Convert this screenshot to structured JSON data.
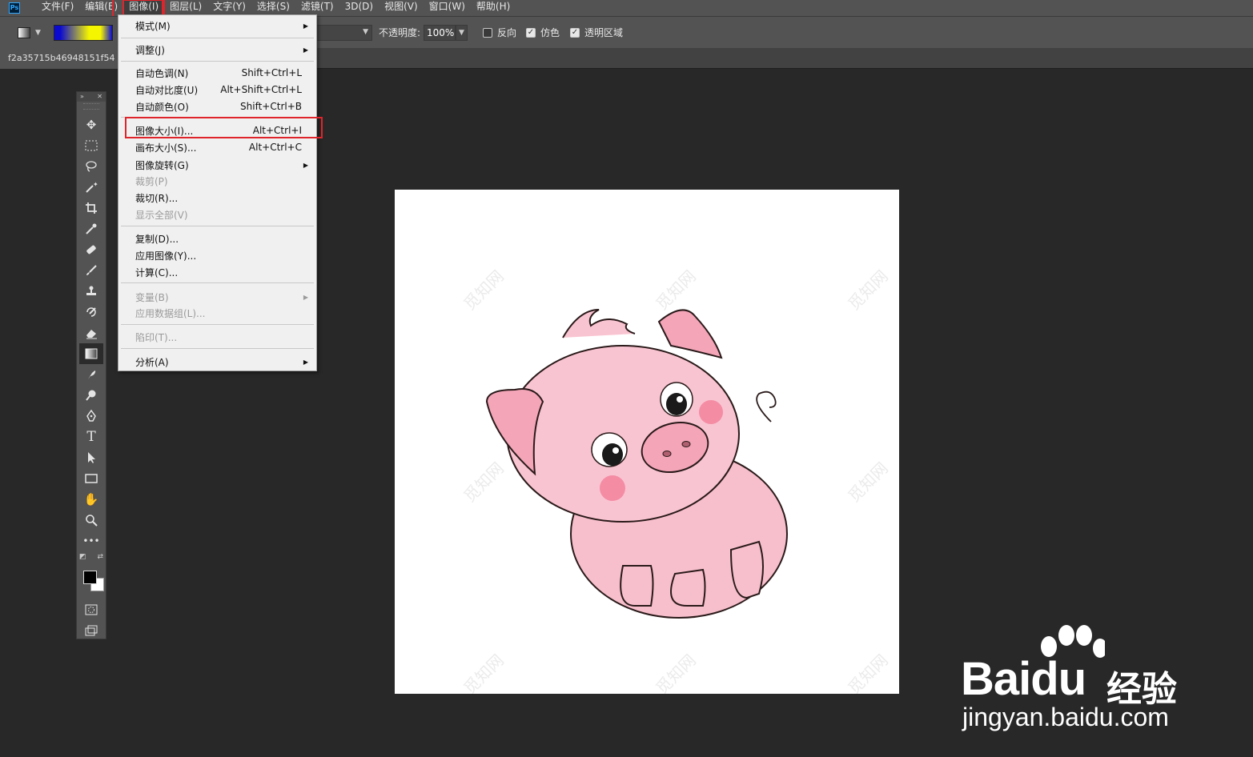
{
  "menubar": {
    "items": [
      "文件(F)",
      "编辑(E)",
      "图像(I)",
      "图层(L)",
      "文字(Y)",
      "选择(S)",
      "滤镜(T)",
      "3D(D)",
      "视图(V)",
      "窗口(W)",
      "帮助(H)"
    ],
    "active_index": 2
  },
  "options": {
    "opacity_label": "不透明度:",
    "opacity_value": "100%",
    "reverse_label": "反向",
    "dither_label": "仿色",
    "transparency_label": "透明区域",
    "reverse_checked": false,
    "dither_checked": true,
    "transparency_checked": true
  },
  "document": {
    "tab_title": "f2a35715b46948151f54"
  },
  "image_menu": {
    "mode": "模式(M)",
    "adjust": "调整(J)",
    "auto_tone": "自动色调(N)",
    "auto_tone_sc": "Shift+Ctrl+L",
    "auto_contrast": "自动对比度(U)",
    "auto_contrast_sc": "Alt+Shift+Ctrl+L",
    "auto_color": "自动颜色(O)",
    "auto_color_sc": "Shift+Ctrl+B",
    "image_size": "图像大小(I)...",
    "image_size_sc": "Alt+Ctrl+I",
    "canvas_size": "画布大小(S)...",
    "canvas_size_sc": "Alt+Ctrl+C",
    "image_rotation": "图像旋转(G)",
    "crop": "裁剪(P)",
    "trim": "裁切(R)...",
    "reveal_all": "显示全部(V)",
    "duplicate": "复制(D)...",
    "apply_image": "应用图像(Y)...",
    "calculations": "计算(C)...",
    "variables": "变量(B)",
    "apply_dataset": "应用数据组(L)...",
    "trap": "陷印(T)...",
    "analysis": "分析(A)"
  },
  "canvas": {
    "watermark": "觅知网"
  },
  "baidu": {
    "brand": "Bai",
    "du": "du",
    "jingyan": "经验",
    "url": "jingyan.baidu.com"
  },
  "icons": {
    "app": "ps-logo-icon",
    "tools": [
      "move-icon",
      "marquee-icon",
      "lasso-icon",
      "magic-wand-icon",
      "crop-icon",
      "eyedropper-icon",
      "healing-brush-icon",
      "brush-icon",
      "clone-stamp-icon",
      "history-brush-icon",
      "eraser-icon",
      "gradient-icon",
      "blur-icon",
      "dodge-icon",
      "pen-icon",
      "type-icon",
      "path-selection-icon",
      "rectangle-icon",
      "hand-icon",
      "zoom-icon",
      "more-tools-icon"
    ]
  },
  "colors": {
    "highlight": "#e0242c",
    "ui_panel": "#535353",
    "workspace": "#282828",
    "pig_pink": "#f7b8c8"
  }
}
